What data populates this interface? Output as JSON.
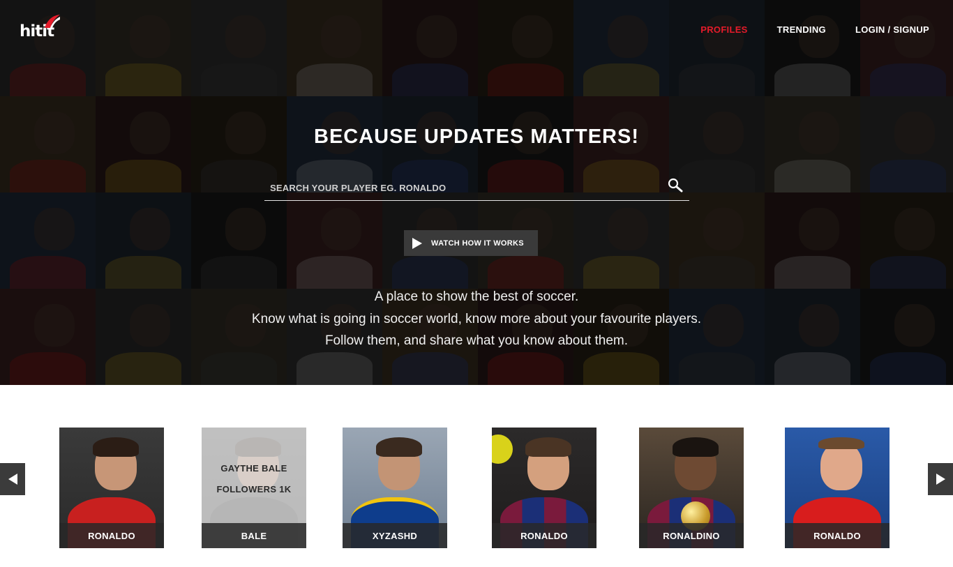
{
  "brand": {
    "logo_text": "hitit",
    "accent_color": "#e51b2a"
  },
  "nav": {
    "items": [
      {
        "label": "PROFILES",
        "active": true
      },
      {
        "label": "TRENDING",
        "active": false
      },
      {
        "label": "LOGIN / SIGNUP",
        "active": false
      }
    ]
  },
  "hero": {
    "headline": "BECAUSE UPDATES MATTERS!",
    "search": {
      "placeholder": "SEARCH YOUR PLAYER EG. RONALDO",
      "icon": "search-icon"
    },
    "watch_button": {
      "label": "WATCH HOW IT WORKS",
      "icon": "play-icon"
    },
    "tagline": {
      "line1": "A place to show the best of soccer.",
      "line2": "Know what is going in soccer world, know more about your favourite players.",
      "line3": "Follow them, and share what you know about them."
    }
  },
  "carousel": {
    "prev_icon": "arrow-left-icon",
    "next_icon": "arrow-right-icon",
    "players": [
      {
        "name": "RONALDO"
      },
      {
        "name": "BALE",
        "hover_title": "GAYTHE BALE",
        "hover_followers": "FOLLOWERS 1K"
      },
      {
        "name": "XYZASHD"
      },
      {
        "name": "RONALDO"
      },
      {
        "name": "RONALDINO"
      },
      {
        "name": "RONALDO"
      }
    ]
  }
}
